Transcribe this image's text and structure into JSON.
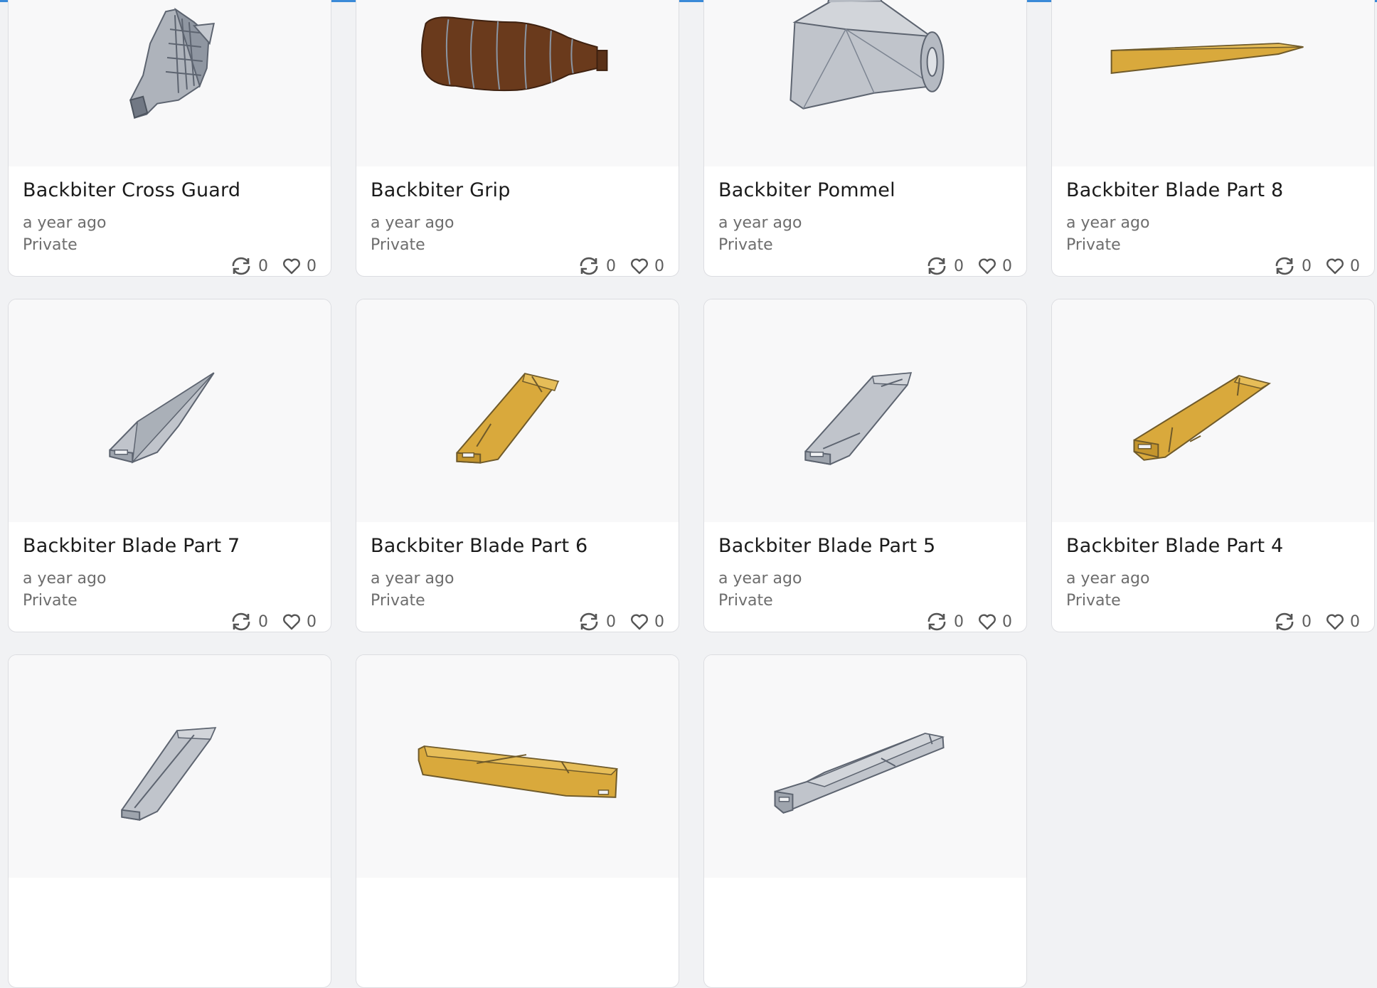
{
  "cards": [
    {
      "title": "Backbiter Cross Guard",
      "date": "a year ago",
      "privacy": "Private",
      "copies": "0",
      "likes": "0",
      "thumbnail": "cross-guard"
    },
    {
      "title": "Backbiter Grip",
      "date": "a year ago",
      "privacy": "Private",
      "copies": "0",
      "likes": "0",
      "thumbnail": "grip"
    },
    {
      "title": "Backbiter Pommel",
      "date": "a year ago",
      "privacy": "Private",
      "copies": "0",
      "likes": "0",
      "thumbnail": "pommel"
    },
    {
      "title": "Backbiter Blade Part 8",
      "date": "a year ago",
      "privacy": "Private",
      "copies": "0",
      "likes": "0",
      "thumbnail": "blade-part-8"
    },
    {
      "title": "Backbiter Blade Part 7",
      "date": "a year ago",
      "privacy": "Private",
      "copies": "0",
      "likes": "0",
      "thumbnail": "blade-part-7"
    },
    {
      "title": "Backbiter Blade Part 6",
      "date": "a year ago",
      "privacy": "Private",
      "copies": "0",
      "likes": "0",
      "thumbnail": "blade-part-6"
    },
    {
      "title": "Backbiter Blade Part 5",
      "date": "a year ago",
      "privacy": "Private",
      "copies": "0",
      "likes": "0",
      "thumbnail": "blade-part-5"
    },
    {
      "title": "Backbiter Blade Part 4",
      "date": "a year ago",
      "privacy": "Private",
      "copies": "0",
      "likes": "0",
      "thumbnail": "blade-part-4"
    },
    {
      "title": "",
      "date": "",
      "privacy": "",
      "copies": "",
      "likes": "",
      "thumbnail": "blade-gray-a"
    },
    {
      "title": "",
      "date": "",
      "privacy": "",
      "copies": "",
      "likes": "",
      "thumbnail": "blade-gold-long"
    },
    {
      "title": "",
      "date": "",
      "privacy": "",
      "copies": "",
      "likes": "",
      "thumbnail": "blade-gray-long"
    }
  ],
  "icons": {
    "copy": "copy-icon",
    "like": "heart-icon"
  },
  "colors": {
    "gray_model": "#b9bec6",
    "gold_model": "#d9a93c",
    "brown_model": "#6a3a1c",
    "accent": "#3a8ad8"
  }
}
